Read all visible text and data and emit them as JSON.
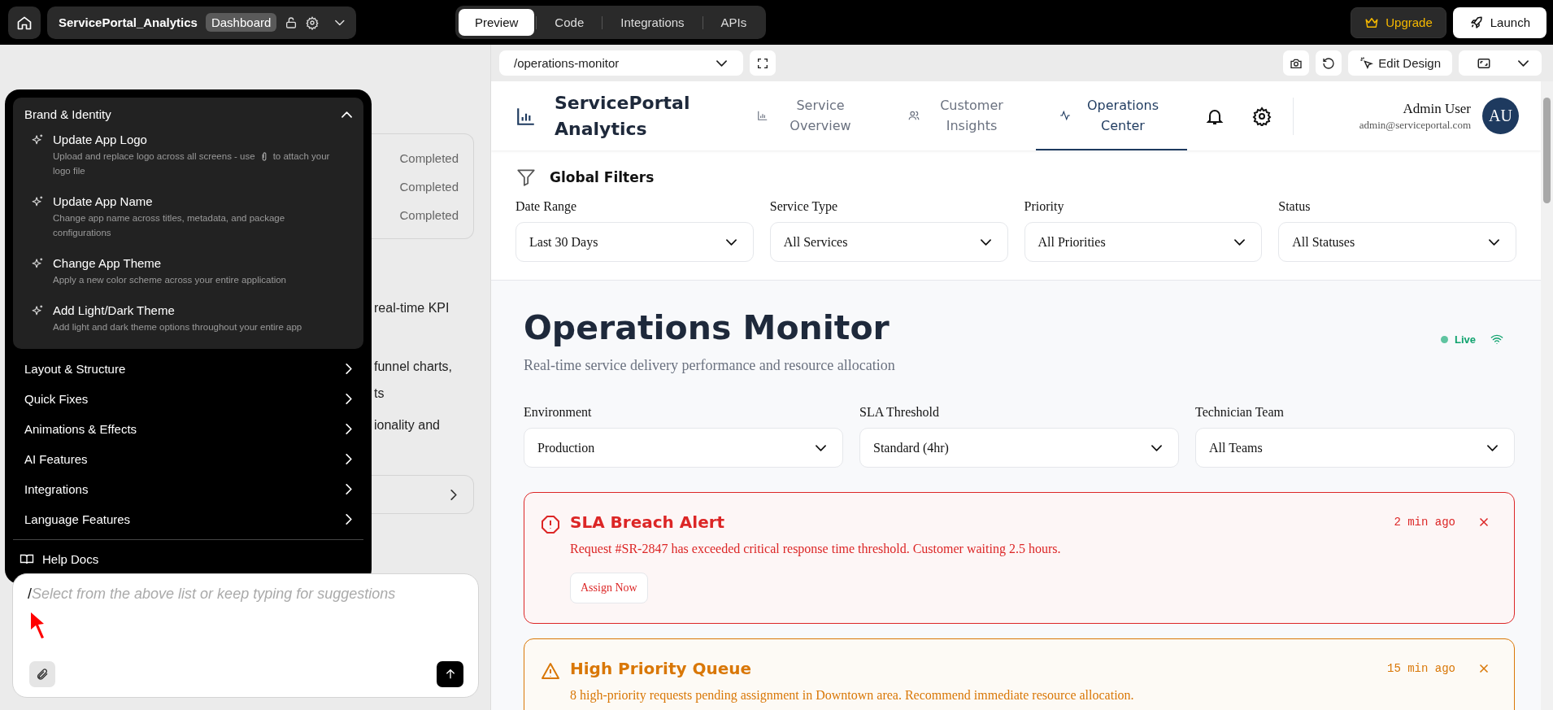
{
  "topbar": {
    "project": "ServicePortal_Analytics",
    "badge": "Dashboard",
    "tabs": [
      {
        "label": "Preview",
        "selected": true
      },
      {
        "label": "Code",
        "selected": false
      },
      {
        "label": "Integrations",
        "selected": false
      },
      {
        "label": "APIs",
        "selected": false
      }
    ],
    "upgrade": "Upgrade",
    "launch": "Launch"
  },
  "chat": {
    "behind": {
      "statuses": [
        "Completed",
        "Completed",
        "Completed"
      ],
      "text_lines": [
        "real-time KPI",
        "funnel charts,",
        "ts",
        "ionality and"
      ]
    },
    "menu": {
      "sections": [
        {
          "title": "Brand & Identity",
          "expanded": true,
          "items": [
            {
              "title": "Update App Logo",
              "desc": "Upload and replace logo across all screens - use",
              "desc_after": "to attach your",
              "desc_next_line": "logo file"
            },
            {
              "title": "Update App Name",
              "desc": "Change app name across titles, metadata, and package configurations"
            },
            {
              "title": "Change App Theme",
              "desc": "Apply a new color scheme across your entire application"
            },
            {
              "title": "Add Light/Dark Theme",
              "desc": "Add light and dark theme options throughout your entire app"
            }
          ]
        },
        {
          "title": "Layout & Structure",
          "expanded": false
        },
        {
          "title": "Quick Fixes",
          "expanded": false
        },
        {
          "title": "Animations & Effects",
          "expanded": false
        },
        {
          "title": "AI Features",
          "expanded": false
        },
        {
          "title": "Integrations",
          "expanded": false
        },
        {
          "title": "Language Features",
          "expanded": false
        }
      ],
      "help": "Help Docs"
    },
    "input": {
      "value": "/",
      "placeholder": "Select from the above list or keep typing for suggestions"
    }
  },
  "toolbar": {
    "route": "/operations-monitor",
    "edit_design": "Edit Design"
  },
  "app": {
    "brand": "ServicePortal Analytics",
    "nav": [
      {
        "label": "Service Overview",
        "selected": false
      },
      {
        "label": "Customer Insights",
        "selected": false
      },
      {
        "label": "Operations Center",
        "selected": true
      }
    ],
    "user": {
      "name": "Admin User",
      "email": "admin@serviceportal.com",
      "initials": "AU"
    },
    "filters": {
      "title": "Global Filters",
      "fields": [
        {
          "label": "Date Range",
          "value": "Last 30 Days"
        },
        {
          "label": "Service Type",
          "value": "All Services"
        },
        {
          "label": "Priority",
          "value": "All Priorities"
        },
        {
          "label": "Status",
          "value": "All Statuses"
        }
      ]
    },
    "monitor": {
      "title": "Operations Monitor",
      "subtitle": "Real-time service delivery performance and resource allocation",
      "live": "Live",
      "selects": [
        {
          "label": "Environment",
          "value": "Production"
        },
        {
          "label": "SLA Threshold",
          "value": "Standard (4hr)"
        },
        {
          "label": "Technician Team",
          "value": "All Teams"
        }
      ],
      "alerts": [
        {
          "kind": "critical",
          "title": "SLA Breach Alert",
          "time": "2 min ago",
          "message": "Request #SR-2847 has exceeded critical response time threshold. Customer waiting 2.5 hours.",
          "action": "Assign Now"
        },
        {
          "kind": "warning",
          "title": "High Priority Queue",
          "time": "15 min ago",
          "message": "8 high-priority requests pending assignment in Downtown area. Recommend immediate resource allocation."
        }
      ]
    }
  }
}
